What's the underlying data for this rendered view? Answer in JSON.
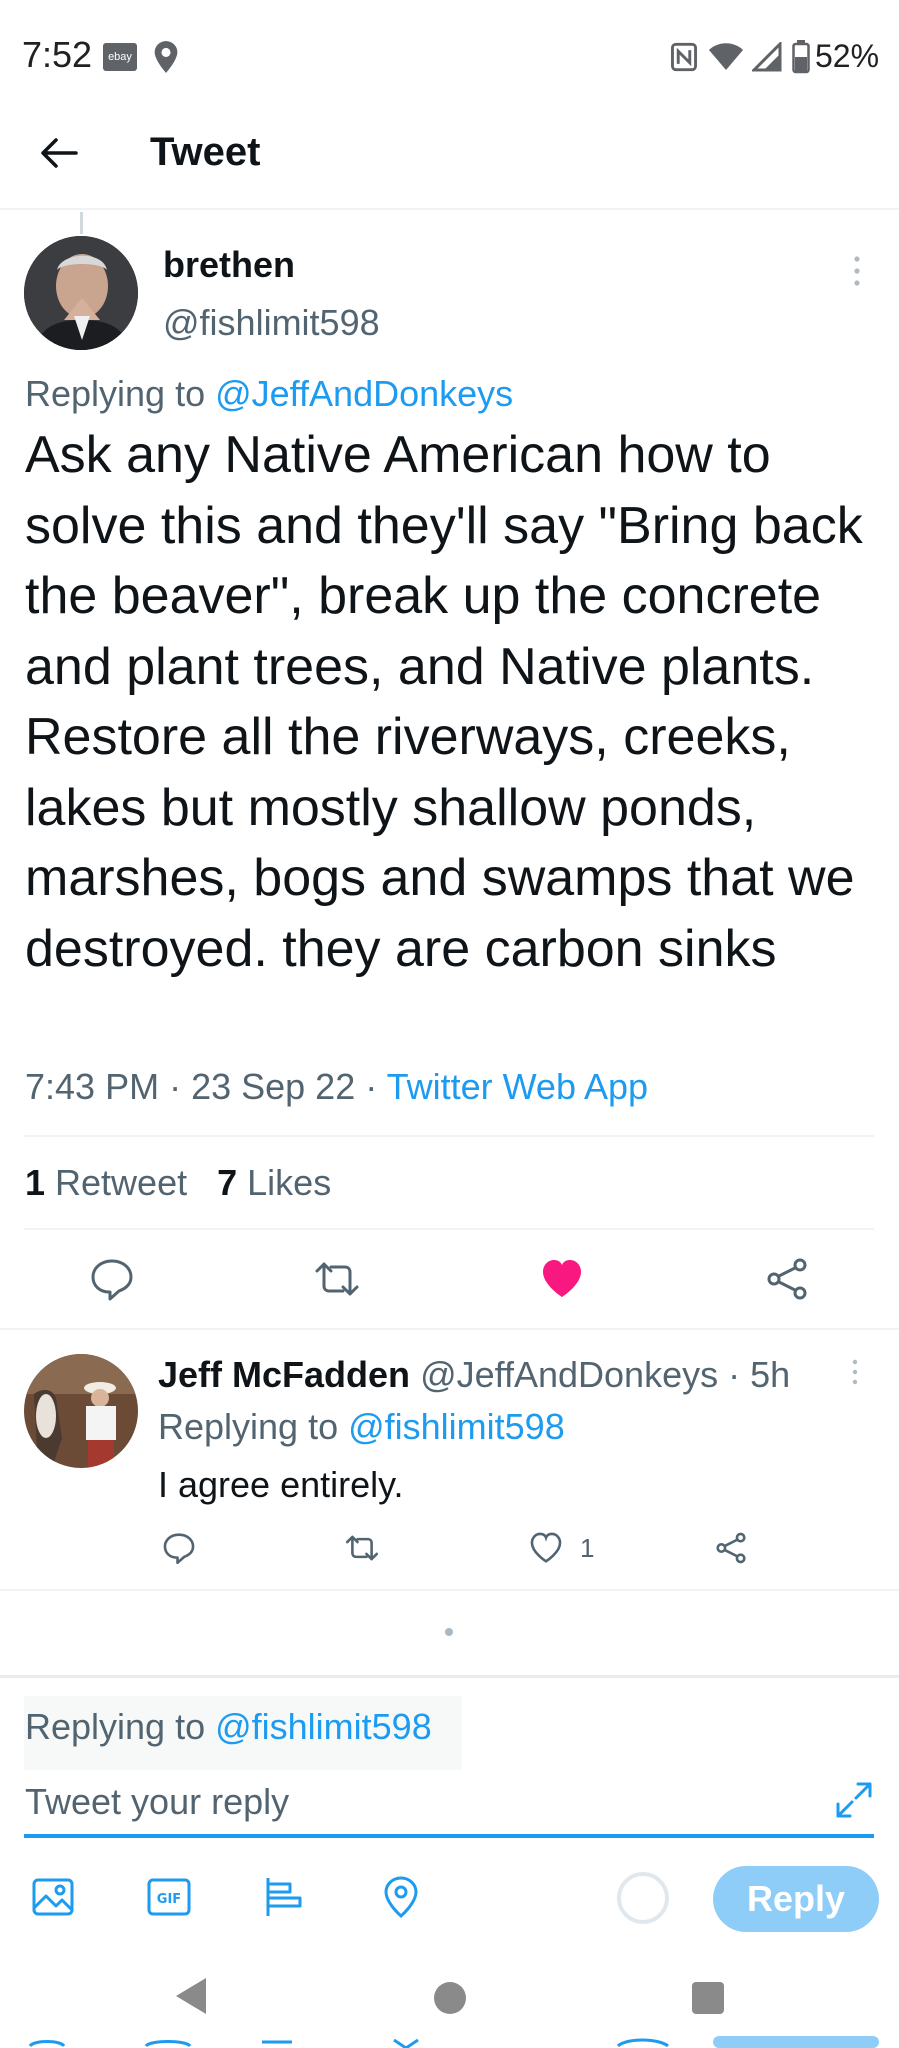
{
  "status_bar": {
    "time": "7:52",
    "ebay_label": "ebay",
    "battery": "52%",
    "icons": [
      "ebay-icon",
      "location-icon",
      "nfc-icon",
      "wifi-icon",
      "signal-icon",
      "battery-icon"
    ]
  },
  "header": {
    "title": "Tweet"
  },
  "tweet": {
    "author_name": "brethen",
    "author_handle": "@fishlimit598",
    "replying_prefix": "Replying to ",
    "replying_to": "@JeffAndDonkeys",
    "text": "Ask any Native American how to solve this and they'll say \"Bring back the beaver\", break up the concrete and plant trees, and Native plants. Restore all the riverways, creeks, lakes but mostly shallow ponds, marshes, bogs and swamps that we destroyed. they are carbon sinks",
    "time": "7:43 PM",
    "date": "23 Sep 22",
    "source": "Twitter Web App",
    "dot": " · ",
    "retweet_count": "1",
    "retweet_label": " Retweet",
    "like_count": "7",
    "like_label": " Likes",
    "liked": true
  },
  "reply": {
    "author_name": "Jeff McFadden",
    "author_handle": "@JeffAndDonkeys",
    "age": "5h",
    "replying_prefix": "Replying to ",
    "replying_to": "@fishlimit598",
    "text": "I agree entirely.",
    "like_count": "1"
  },
  "composer": {
    "replying_prefix": "Replying to ",
    "replying_to": "@fishlimit598",
    "placeholder": "Tweet your reply",
    "reply_button": "Reply"
  },
  "colors": {
    "accent": "#1d9bf0",
    "like": "#f91880",
    "text": "#0f1419",
    "secondary": "#536471",
    "reply_button_disabled": "#8ecdf8"
  }
}
